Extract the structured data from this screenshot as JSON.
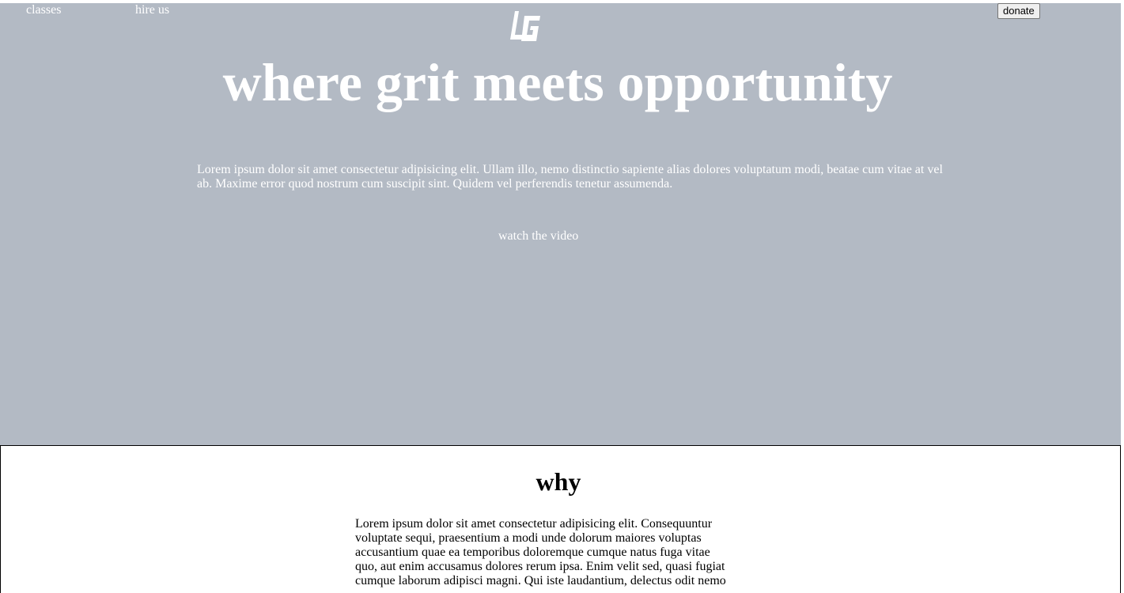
{
  "nav": {
    "classes_label": "classes",
    "hire_label": "hire us",
    "donate_label": "donate",
    "logo_icon": "lg-monogram-logo-icon"
  },
  "hero": {
    "title": "where grit meets opportunity",
    "text": "Lorem ipsum dolor sit amet consectetur adipisicing elit. Ullam illo, nemo distinctio sapiente alias dolores voluptatum modi, beatae cum vitae at vel ab. Maxime error quod nostrum cum suscipit sint. Quidem vel perferendis tenetur assumenda.",
    "video_link": "watch the video",
    "background_color": "#b3bac4",
    "text_color": "#ffffff"
  },
  "why": {
    "title": "why",
    "text": "Lorem ipsum dolor sit amet consectetur adipisicing elit. Consequuntur voluptate sequi, praesentium a modi unde dolorum maiores voluptas accusantium quae ea temporibus doloremque cumque natus fuga vitae quo, aut enim accusamus dolores rerum ipsa. Enim velit sed, quasi fugiat cumque laborum adipisci magni. Qui iste laudantium, delectus odit nemo"
  }
}
